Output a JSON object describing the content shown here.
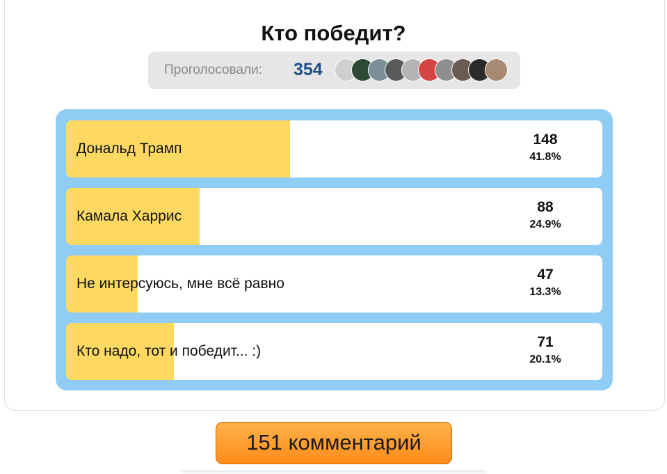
{
  "poll": {
    "title": "Кто победит?",
    "voters_label": "Проголосовали:",
    "voters_count": "354",
    "avatars": [
      {
        "name": "avatar-1",
        "color": "#cfcfcf"
      },
      {
        "name": "avatar-2",
        "color": "#2e4a37"
      },
      {
        "name": "avatar-3",
        "color": "#7b8f99"
      },
      {
        "name": "avatar-4",
        "color": "#5a5a5a"
      },
      {
        "name": "avatar-5",
        "color": "#b4b4b4"
      },
      {
        "name": "avatar-6",
        "color": "#d64545"
      },
      {
        "name": "avatar-7",
        "color": "#8f8f8f"
      },
      {
        "name": "avatar-8",
        "color": "#6b5b52"
      },
      {
        "name": "avatar-9",
        "color": "#2b2b2b"
      },
      {
        "name": "avatar-10",
        "color": "#a88a74"
      }
    ],
    "options": [
      {
        "label": "Дональд Трамп",
        "count": "148",
        "percent": "41.8%",
        "share": 0.418
      },
      {
        "label": "Камала Харрис",
        "count": "88",
        "percent": "24.9%",
        "share": 0.249
      },
      {
        "label": "Не интерсуюсь, мне всё равно",
        "count": "47",
        "percent": "13.3%",
        "share": 0.133
      },
      {
        "label": "Кто надо, тот и победит... :)",
        "count": "71",
        "percent": "20.1%",
        "share": 0.201
      }
    ],
    "comments_button": "151 комментарий"
  },
  "colors": {
    "frame": "#8fcdf5",
    "fill": "#fdd962",
    "count": "#1f4f8c",
    "button": "#ff9a2e"
  }
}
